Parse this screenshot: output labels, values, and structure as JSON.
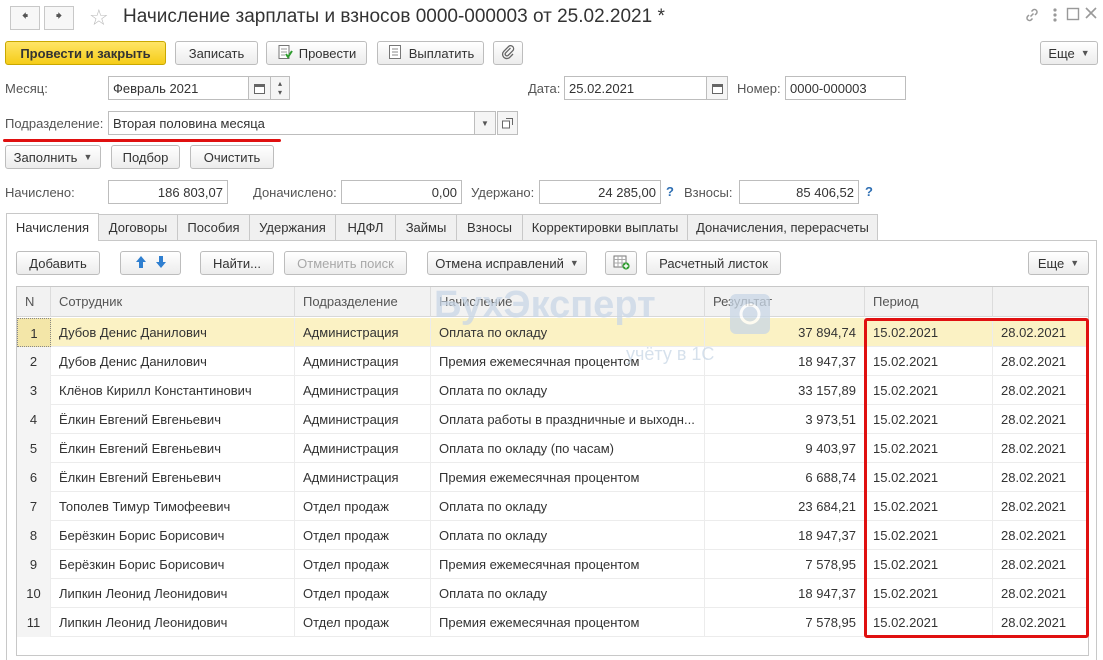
{
  "window": {
    "title": "Начисление зарплаты и взносов 0000-000003 от 25.02.2021 *"
  },
  "toolbar": {
    "post_close": "Провести и закрыть",
    "write": "Записать",
    "post": "Провести",
    "pay": "Выплатить",
    "more": "Еще"
  },
  "form": {
    "month_label": "Месяц:",
    "month_value": "Февраль 2021",
    "date_label": "Дата:",
    "date_value": "25.02.2021",
    "number_label": "Номер:",
    "number_value": "0000-000003",
    "division_label": "Подразделение:",
    "division_value": "Вторая половина месяца",
    "fill": "Заполнить",
    "pick": "Подбор",
    "clear": "Очистить",
    "accrued_label": "Начислено:",
    "accrued_value": "186 803,07",
    "extra_label": "Доначислено:",
    "extra_value": "0,00",
    "withheld_label": "Удержано:",
    "withheld_value": "24 285,00",
    "contrib_label": "Взносы:",
    "contrib_value": "85 406,52"
  },
  "tabs": [
    "Начисления",
    "Договоры",
    "Пособия",
    "Удержания",
    "НДФЛ",
    "Займы",
    "Взносы",
    "Корректировки выплаты",
    "Доначисления, перерасчеты"
  ],
  "table_toolbar": {
    "add": "Добавить",
    "find": "Найти...",
    "cancel_search": "Отменить поиск",
    "cancel_fixes": "Отмена исправлений",
    "payslip": "Расчетный листок",
    "more": "Еще"
  },
  "grid": {
    "headers": [
      "N",
      "Сотрудник",
      "Подразделение",
      "Начисление",
      "Результат",
      "Период"
    ],
    "rows": [
      {
        "n": "1",
        "employee": "Дубов Денис Данилович",
        "division": "Администрация",
        "accrual": "Оплата по окладу",
        "result": "37 894,74",
        "from": "15.02.2021",
        "to": "28.02.2021"
      },
      {
        "n": "2",
        "employee": "Дубов Денис Данилович",
        "division": "Администрация",
        "accrual": "Премия ежемесячная процентом",
        "result": "18 947,37",
        "from": "15.02.2021",
        "to": "28.02.2021"
      },
      {
        "n": "3",
        "employee": "Клёнов Кирилл Константинович",
        "division": "Администрация",
        "accrual": "Оплата по окладу",
        "result": "33 157,89",
        "from": "15.02.2021",
        "to": "28.02.2021"
      },
      {
        "n": "4",
        "employee": "Ёлкин Евгений Евгеньевич",
        "division": "Администрация",
        "accrual": "Оплата работы в праздничные и выходн...",
        "result": "3 973,51",
        "from": "15.02.2021",
        "to": "28.02.2021"
      },
      {
        "n": "5",
        "employee": "Ёлкин Евгений Евгеньевич",
        "division": "Администрация",
        "accrual": "Оплата по окладу (по часам)",
        "result": "9 403,97",
        "from": "15.02.2021",
        "to": "28.02.2021"
      },
      {
        "n": "6",
        "employee": "Ёлкин Евгений Евгеньевич",
        "division": "Администрация",
        "accrual": "Премия ежемесячная процентом",
        "result": "6 688,74",
        "from": "15.02.2021",
        "to": "28.02.2021"
      },
      {
        "n": "7",
        "employee": "Тополев Тимур Тимофеевич",
        "division": "Отдел продаж",
        "accrual": "Оплата по окладу",
        "result": "23 684,21",
        "from": "15.02.2021",
        "to": "28.02.2021"
      },
      {
        "n": "8",
        "employee": "Берёзкин Борис Борисович",
        "division": "Отдел продаж",
        "accrual": "Оплата по окладу",
        "result": "18 947,37",
        "from": "15.02.2021",
        "to": "28.02.2021"
      },
      {
        "n": "9",
        "employee": "Берёзкин Борис Борисович",
        "division": "Отдел продаж",
        "accrual": "Премия ежемесячная процентом",
        "result": "7 578,95",
        "from": "15.02.2021",
        "to": "28.02.2021"
      },
      {
        "n": "10",
        "employee": "Липкин Леонид Леонидович",
        "division": "Отдел продаж",
        "accrual": "Оплата по окладу",
        "result": "18 947,37",
        "from": "15.02.2021",
        "to": "28.02.2021"
      },
      {
        "n": "11",
        "employee": "Липкин Леонид Леонидович",
        "division": "Отдел продаж",
        "accrual": "Премия ежемесячная процентом",
        "result": "7 578,95",
        "from": "15.02.2021",
        "to": "28.02.2021"
      }
    ]
  },
  "watermark": {
    "brand": "БухЭксперт",
    "tagline": "учёту в 1С"
  },
  "icons": {
    "back": "arrow-left-icon",
    "forward": "arrow-right-icon",
    "favorite": "star-icon",
    "link": "link-icon",
    "menu": "more-vertical-icon",
    "maximize": "maximize-icon",
    "close": "close-icon",
    "calendar": "calendar-icon"
  },
  "colors": {
    "primary_button": "#f5cc18",
    "selected_row": "#fbf2c4",
    "annotation_red": "#e01010",
    "help_blue": "#2f6fb3"
  }
}
